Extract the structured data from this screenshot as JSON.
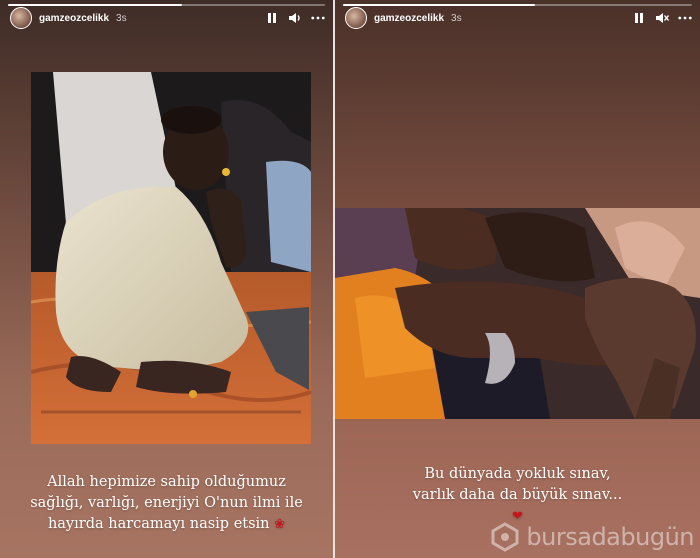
{
  "stories": [
    {
      "username": "gamzeozcelikk",
      "time": "3s",
      "progress": 0.55,
      "caption_lines": [
        "Allah hepimize sahip olduğumuz",
        "sağlığı, varlığı, enerjiyi O'nun ilmi ile",
        "hayırda harcamayı nasip etsin"
      ],
      "emoji": "rose",
      "photo_icon": "child-sitting-photo"
    },
    {
      "username": "gamzeozcelikk",
      "time": "3s",
      "progress": 0.55,
      "caption_lines": [
        "Bu dünyada yokluk sınav,",
        "varlık daha da büyük sınav..."
      ],
      "emoji": "red-heart",
      "photo_icon": "children-hands-photo"
    }
  ],
  "watermark": {
    "text": "bursadabugün"
  },
  "colors": {
    "accent_heart": "#c4161c",
    "text": "#ffffff"
  }
}
